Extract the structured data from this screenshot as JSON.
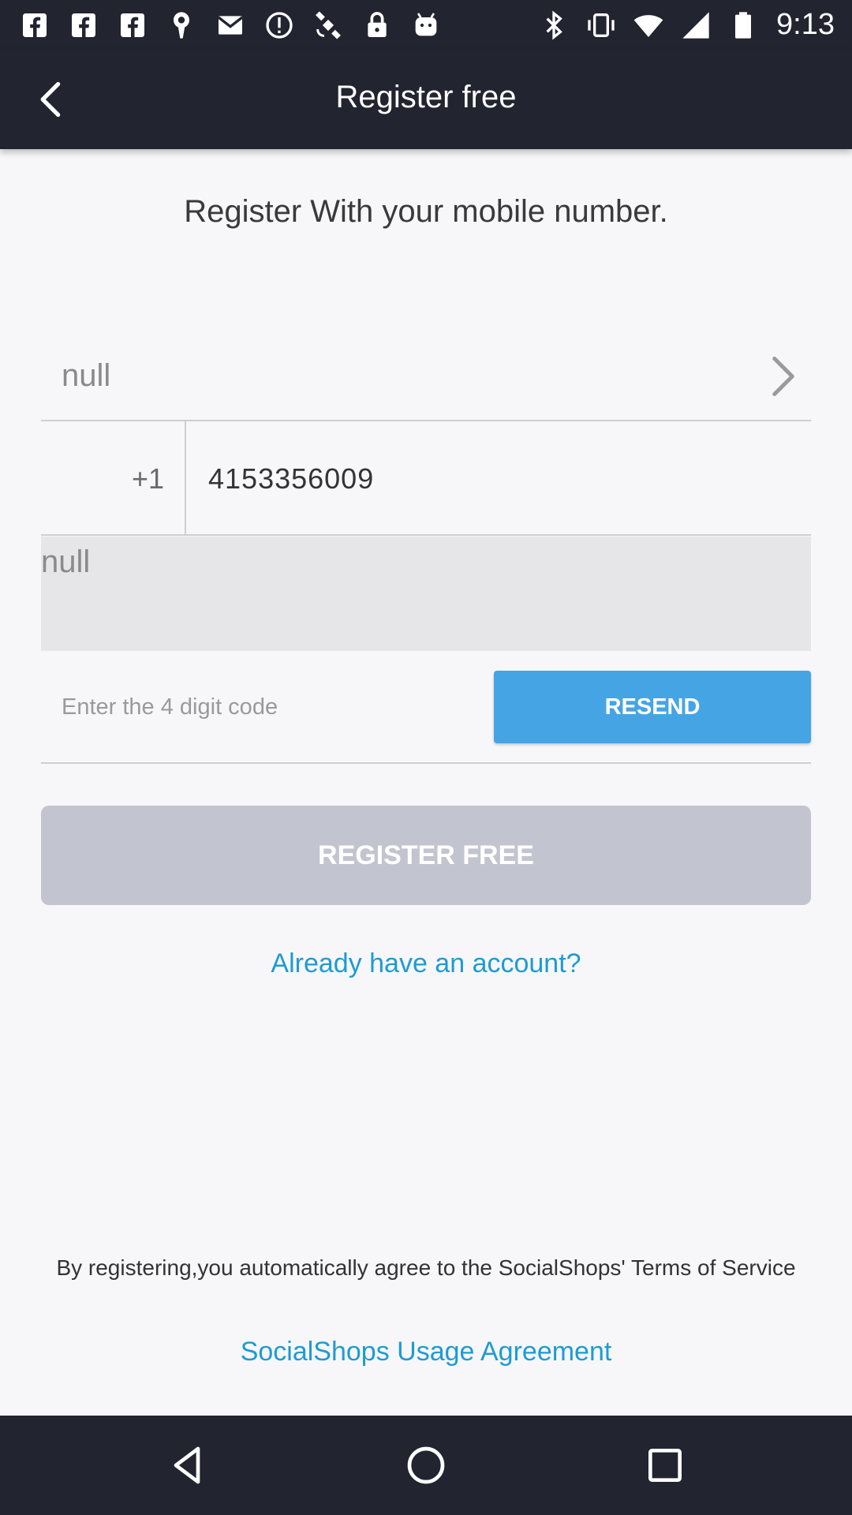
{
  "status_bar": {
    "time": "9:13",
    "left_icons": [
      "facebook-icon",
      "facebook-icon",
      "facebook-icon",
      "location-pin-icon",
      "mail-icon",
      "alert-circle-icon",
      "satellite-icon",
      "lock-icon",
      "android-icon"
    ],
    "right_icons": [
      "bluetooth-icon",
      "vibrate-icon",
      "wifi-icon",
      "signal-icon",
      "battery-icon"
    ]
  },
  "app_bar": {
    "title": "Register free"
  },
  "main": {
    "heading": "Register With your mobile number.",
    "country_value": "null",
    "country_code": "+1",
    "phone_number": "4153356009",
    "captcha_text": "null",
    "code_placeholder": "Enter the 4 digit code",
    "resend_label": "RESEND",
    "register_label": "REGISTER FREE",
    "login_link": "Already have an account?"
  },
  "footer": {
    "terms_text": "By registering,you automatically agree to the SocialShops' Terms of Service",
    "agreement_link": "SocialShops Usage Agreement"
  },
  "colors": {
    "bar_background": "#222430",
    "page_background": "#f7f7f9",
    "accent_blue": "#45a5e4",
    "link_blue": "#1e9bd3",
    "disabled_button": "#c2c5cf"
  }
}
